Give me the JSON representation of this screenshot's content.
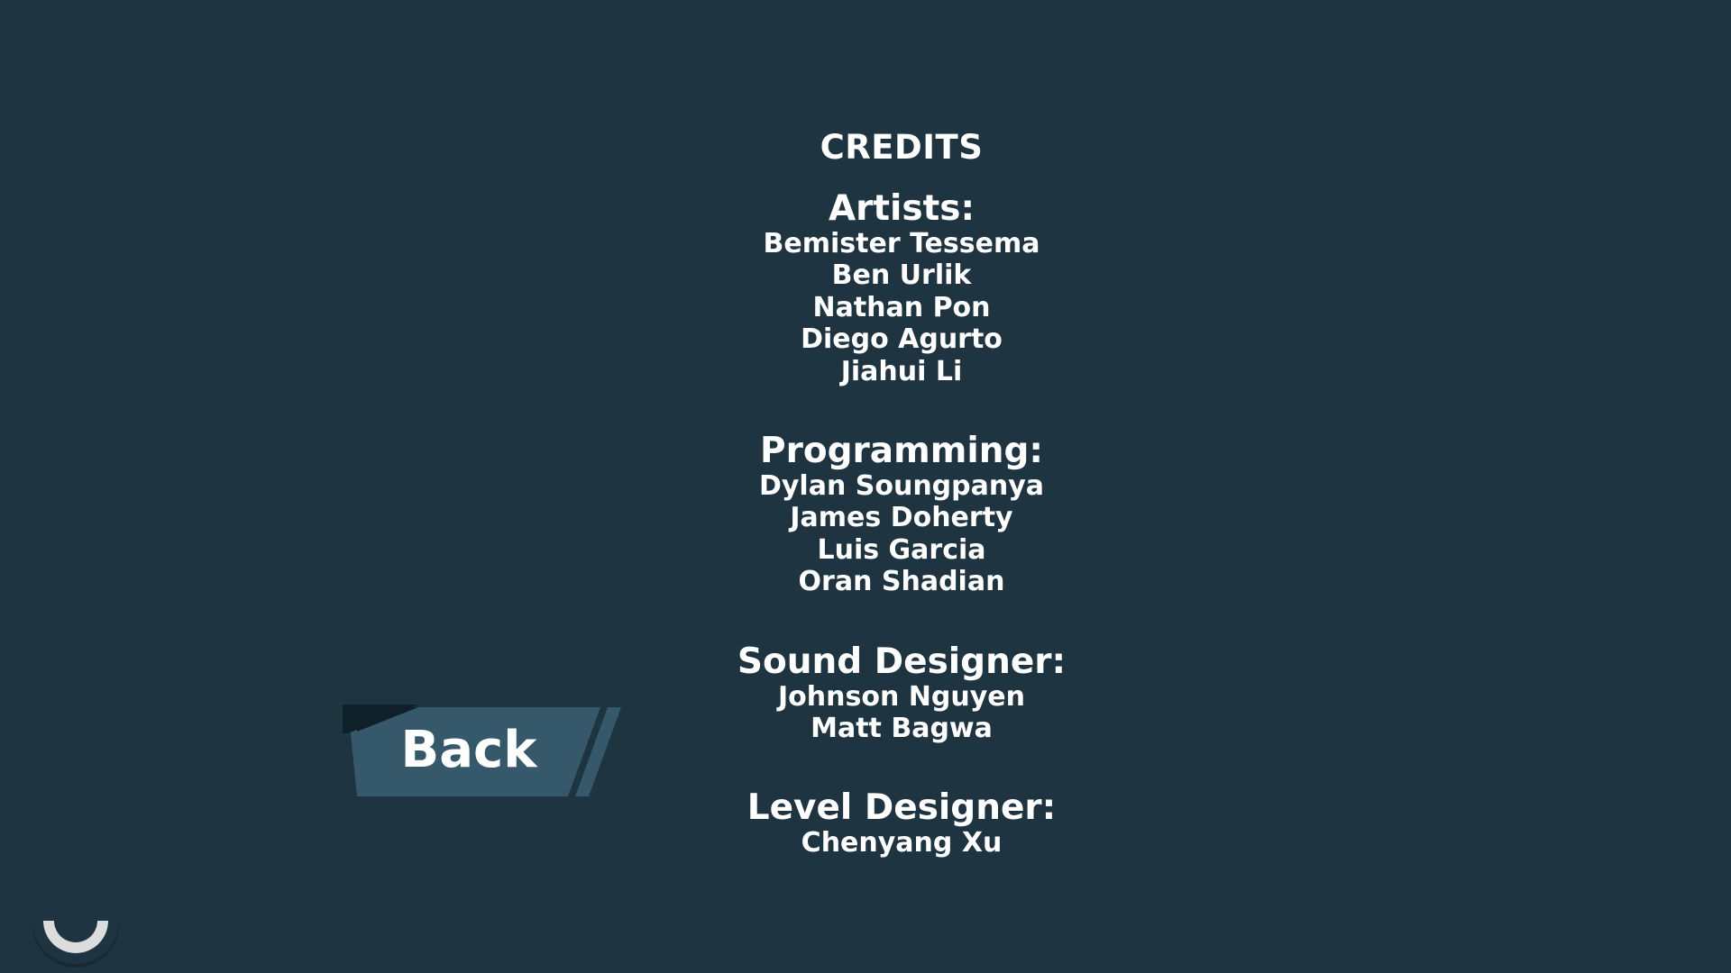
{
  "credits": {
    "title": "CREDITS",
    "sections": [
      {
        "heading": "Artists:",
        "names": [
          "Bemister Tessema",
          "Ben Urlik",
          "Nathan Pon",
          "Diego Agurto",
          "Jiahui Li"
        ]
      },
      {
        "heading": "Programming:",
        "names": [
          "Dylan Soungpanya",
          "James Doherty",
          "Luis Garcia",
          "Oran Shadian"
        ]
      },
      {
        "heading": "Sound Designer:",
        "names": [
          "Johnson Nguyen",
          "Matt Bagwa"
        ]
      },
      {
        "heading": "Level Designer:",
        "names": [
          "Chenyang Xu"
        ]
      }
    ]
  },
  "back_button": {
    "label": "Back"
  },
  "colors": {
    "background": "#1e3440",
    "button_fill": "#35596a",
    "button_corner": "#0f2028",
    "text": "#ffffff"
  },
  "icons": {
    "loading": "loading-spinner-icon"
  }
}
